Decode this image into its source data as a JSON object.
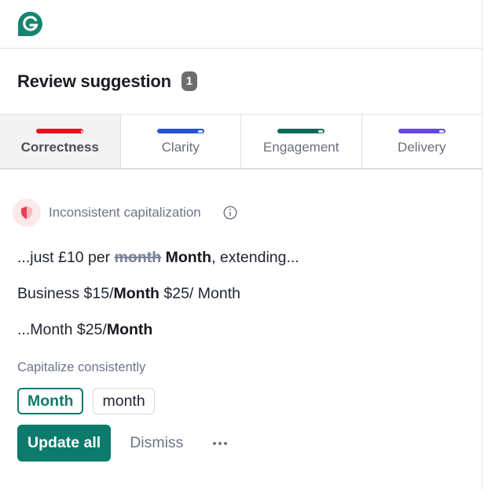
{
  "app": {
    "logo_icon": "grammarly-logo-icon",
    "brand_color": "#15846f"
  },
  "header": {
    "title": "Review suggestion",
    "count": "1"
  },
  "tabs": [
    {
      "label": "Correctness",
      "color": "#e4131a",
      "active": true
    },
    {
      "label": "Clarity",
      "color": "#2353d6",
      "active": false
    },
    {
      "label": "Engagement",
      "color": "#0b6a57",
      "active": false
    },
    {
      "label": "Delivery",
      "color": "#6548e0",
      "active": false
    }
  ],
  "issue": {
    "icon": "shield-icon",
    "title": "Inconsistent capitalization",
    "info_icon": "info-icon",
    "lines": [
      {
        "before": "...just £10 per ",
        "removed": "month",
        "added": "Month",
        "after": ", extending..."
      },
      {
        "before": "Business $15/",
        "added": "Month",
        "after": " $25/ Month"
      },
      {
        "before": "...Month $25/",
        "added": "Month",
        "after": ""
      }
    ],
    "hint": "Capitalize consistently",
    "options": [
      "Month",
      "month"
    ]
  },
  "actions": {
    "update_label": "Update all",
    "dismiss_label": "Dismiss",
    "more_icon": "more-icon"
  }
}
